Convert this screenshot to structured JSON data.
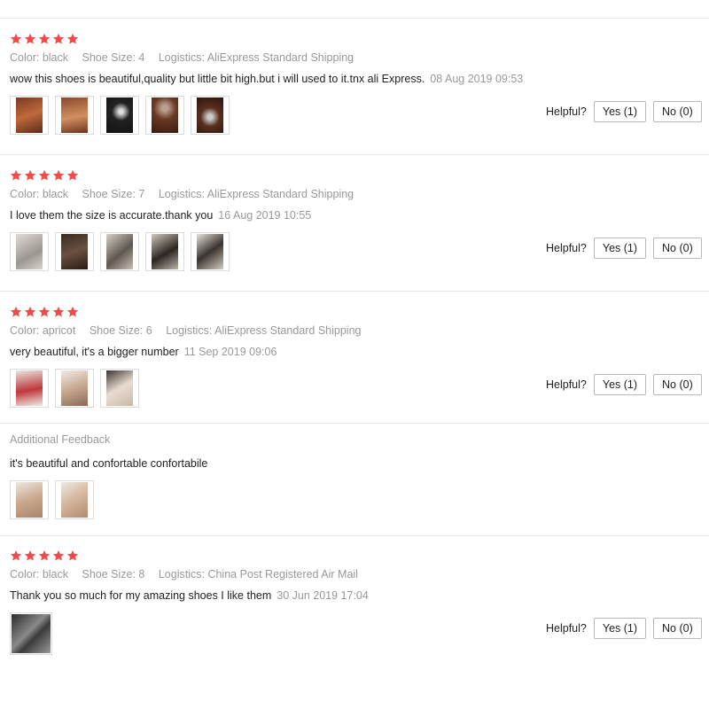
{
  "colors": {
    "star": "#f24a4a",
    "muted": "#999999",
    "border": "#b8b8b8"
  },
  "icons": {
    "star": "star-icon"
  },
  "reviews": [
    {
      "rating": 5,
      "color": "Color: black",
      "size": "Shoe Size: 4",
      "logistics": "Logistics: AliExpress Standard Shipping",
      "text": "wow this shoes is beautiful,quality but little bit high.but i will used to it.tnx ali Express.",
      "date": "08 Aug 2019 09:53",
      "photos": 5,
      "helpful_label": "Helpful?",
      "yes_label": "Yes (1)",
      "no_label": "No (0)"
    },
    {
      "rating": 5,
      "color": "Color: black",
      "size": "Shoe Size: 7",
      "logistics": "Logistics: AliExpress Standard Shipping",
      "text": "I love them the size is accurate.thank you",
      "date": "16 Aug 2019 10:55",
      "photos": 5,
      "helpful_label": "Helpful?",
      "yes_label": "Yes (1)",
      "no_label": "No (0)"
    },
    {
      "rating": 5,
      "color": "Color: apricot",
      "size": "Shoe Size: 6",
      "logistics": "Logistics: AliExpress Standard Shipping",
      "text": "very beautiful, it's a bigger number",
      "date": "11 Sep 2019 09:06",
      "photos": 3,
      "helpful_label": "Helpful?",
      "yes_label": "Yes (1)",
      "no_label": "No (0)",
      "additional": {
        "heading": "Additional Feedback",
        "text": "it's beautiful and confortable confortabile",
        "photos": 2
      }
    },
    {
      "rating": 5,
      "color": "Color: black",
      "size": "Shoe Size: 8",
      "logistics": "Logistics: China Post Registered Air Mail",
      "text": "Thank you so much for my amazing shoes I like them",
      "date": "30 Jun 2019 17:04",
      "photos": 1,
      "helpful_label": "Helpful?",
      "yes_label": "Yes (1)",
      "no_label": "No (0)"
    }
  ]
}
